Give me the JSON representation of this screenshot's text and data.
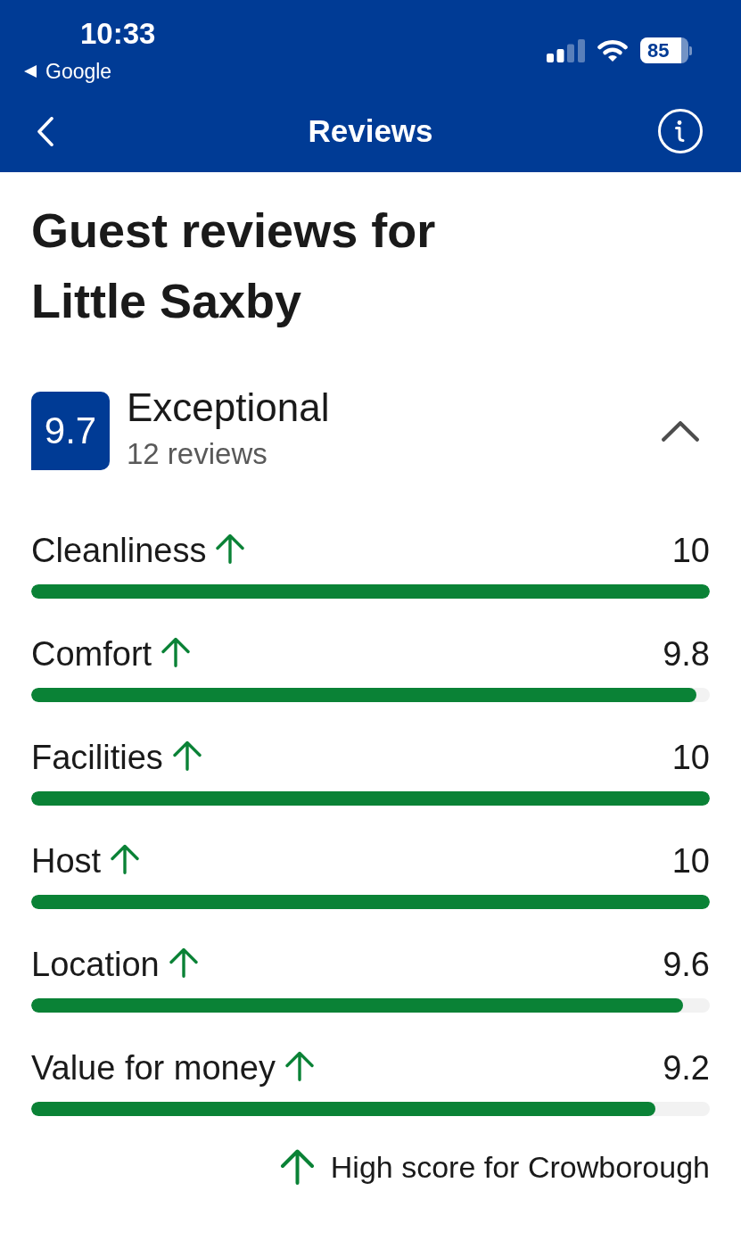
{
  "status_bar": {
    "time": "10:33",
    "back_app": "Google",
    "battery": "85"
  },
  "nav": {
    "title": "Reviews"
  },
  "heading": "Guest reviews for Little Saxby",
  "summary": {
    "score": "9.7",
    "rating": "Exceptional",
    "review_count": "12 reviews",
    "expanded": true
  },
  "categories": [
    {
      "name": "Cleanliness",
      "score": "10",
      "high_score": true,
      "level": 1.0
    },
    {
      "name": "Comfort",
      "score": "9.8",
      "high_score": true,
      "level": 0.98
    },
    {
      "name": "Facilities",
      "score": "10",
      "high_score": true,
      "level": 1.0
    },
    {
      "name": "Host",
      "score": "10",
      "high_score": true,
      "level": 1.0
    },
    {
      "name": "Location",
      "score": "9.6",
      "high_score": true,
      "level": 0.96
    },
    {
      "name": "Value for money",
      "score": "9.2",
      "high_score": true,
      "level": 0.92
    }
  ],
  "legend": {
    "text": "High score for Crowborough"
  }
}
